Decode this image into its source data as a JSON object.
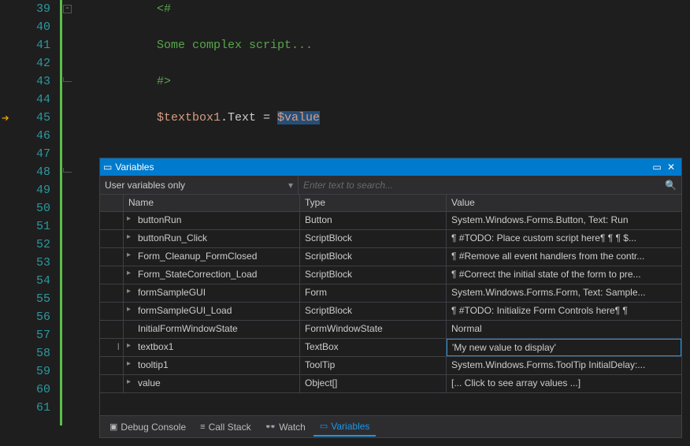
{
  "editor": {
    "lines": [
      {
        "num": "39",
        "tokens": [
          {
            "cls": "tk-comment",
            "t": "<#"
          }
        ],
        "fold": "minus"
      },
      {
        "num": "40",
        "tokens": []
      },
      {
        "num": "41",
        "tokens": [
          {
            "cls": "tk-comment",
            "t": "Some complex script..."
          }
        ]
      },
      {
        "num": "42",
        "tokens": []
      },
      {
        "num": "43",
        "tokens": [
          {
            "cls": "tk-comment",
            "t": "#>"
          }
        ],
        "foldEnd": true
      },
      {
        "num": "44",
        "tokens": []
      },
      {
        "num": "45",
        "tokens": [
          {
            "cls": "tk-var",
            "t": "$textbox1"
          },
          {
            "cls": "tk-op",
            "t": ".Text = "
          },
          {
            "cls": "tk-var tk-sel",
            "t": "$value"
          }
        ],
        "arrow": true
      },
      {
        "num": "46",
        "tokens": []
      },
      {
        "num": "47",
        "tokens": []
      },
      {
        "num": "48",
        "tokens": [
          {
            "cls": "tk-punct",
            "t": "}"
          }
        ],
        "outdent": true,
        "foldEnd": true
      },
      {
        "num": "49",
        "tokens": []
      },
      {
        "num": "50",
        "tokens": []
      },
      {
        "num": "51",
        "tokens": []
      },
      {
        "num": "52",
        "tokens": []
      },
      {
        "num": "53",
        "tokens": []
      },
      {
        "num": "54",
        "tokens": []
      },
      {
        "num": "55",
        "tokens": []
      },
      {
        "num": "56",
        "tokens": []
      },
      {
        "num": "57",
        "tokens": []
      },
      {
        "num": "58",
        "tokens": []
      },
      {
        "num": "59",
        "tokens": []
      },
      {
        "num": "60",
        "tokens": []
      },
      {
        "num": "61",
        "tokens": []
      }
    ]
  },
  "panel": {
    "title": "Variables",
    "filter_mode": "User variables only",
    "search_placeholder": "Enter text to search...",
    "headers": {
      "name": "Name",
      "type": "Type",
      "value": "Value"
    },
    "cursor_row_index": 7,
    "highlight_row_index": 7,
    "rows": [
      {
        "name": "buttonRun",
        "type": "Button",
        "value": "System.Windows.Forms.Button, Text: Run",
        "exp": true
      },
      {
        "name": "buttonRun_Click",
        "type": "ScriptBlock",
        "value": "¶  #TODO: Place custom script here¶  ¶  ¶  $...",
        "exp": true
      },
      {
        "name": "Form_Cleanup_FormClosed",
        "type": "ScriptBlock",
        "value": "¶  #Remove all event handlers from the contr...",
        "exp": true
      },
      {
        "name": "Form_StateCorrection_Load",
        "type": "ScriptBlock",
        "value": "¶  #Correct the initial state of the form to pre...",
        "exp": true
      },
      {
        "name": "formSampleGUI",
        "type": "Form",
        "value": "System.Windows.Forms.Form, Text: Sample...",
        "exp": true
      },
      {
        "name": "formSampleGUI_Load",
        "type": "ScriptBlock",
        "value": "¶   #TODO: Initialize Form Controls here¶  ¶",
        "exp": true
      },
      {
        "name": "InitialFormWindowState",
        "type": "FormWindowState",
        "value": "Normal",
        "exp": false
      },
      {
        "name": "textbox1",
        "type": "TextBox",
        "value": "'My new value to display'",
        "exp": true
      },
      {
        "name": "tooltip1",
        "type": "ToolTip",
        "value": "System.Windows.Forms.ToolTip InitialDelay:...",
        "exp": true
      },
      {
        "name": "value",
        "type": "Object[]",
        "value": "[... Click to see array values ...]",
        "exp": true
      }
    ],
    "tabs": [
      {
        "label": "Debug Console",
        "active": false,
        "icon": "▣"
      },
      {
        "label": "Call Stack",
        "active": false,
        "icon": "≡"
      },
      {
        "label": "Watch",
        "active": false,
        "icon": "👓"
      },
      {
        "label": "Variables",
        "active": true,
        "icon": "▭"
      }
    ]
  }
}
